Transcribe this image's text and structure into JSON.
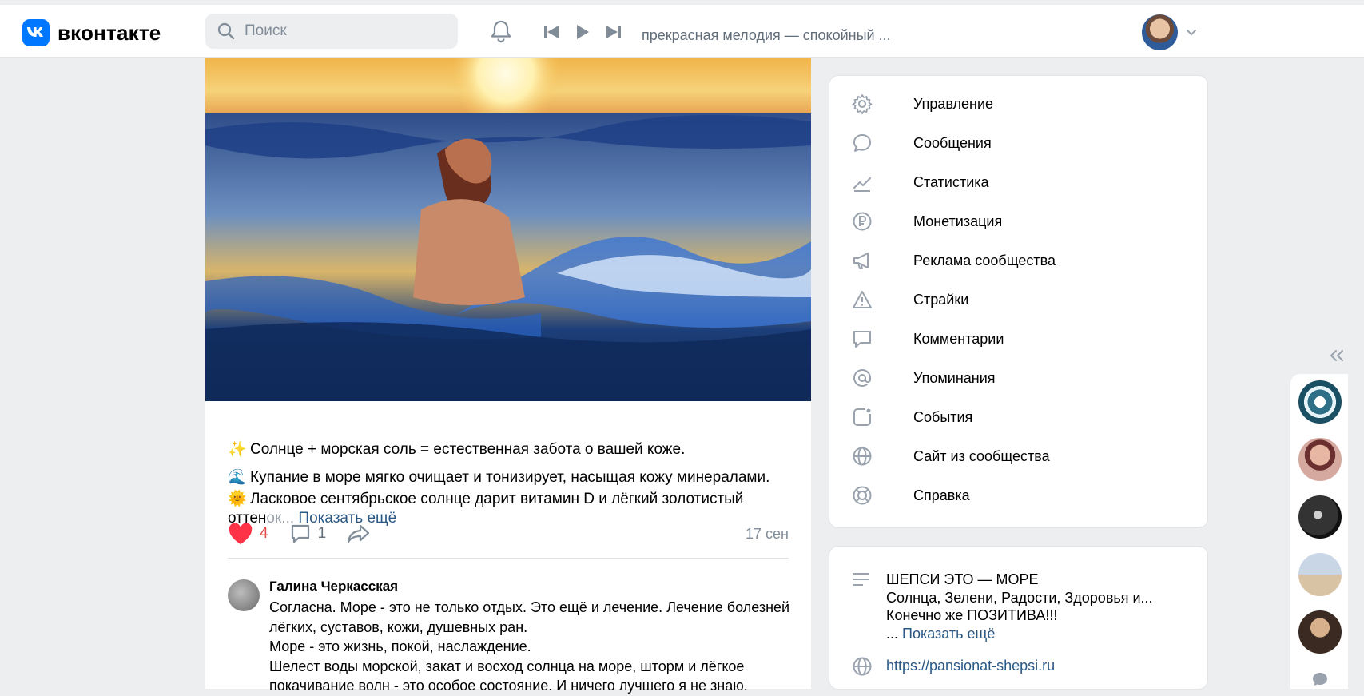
{
  "header": {
    "logo_text": "вконтакте",
    "search_placeholder": "Поиск",
    "track_title": "прекрасная мелодия — спокойный ...",
    "icons": [
      "vk-logo-icon",
      "search-icon",
      "bell-icon",
      "prev-track-icon",
      "play-icon",
      "next-track-icon",
      "chevron-down-icon"
    ]
  },
  "post": {
    "lines": [
      {
        "emoji": "✨",
        "text": "Солнце + морская соль = естественная забота о вашей коже."
      },
      {
        "emoji": "🌊",
        "text": "Купание в море мягко очищает и тонизирует, насыщая кожу минералами."
      },
      {
        "emoji": "🌞",
        "text": "Ласковое сентябрьское солнце дарит витамин D и лёгкий золотистый"
      }
    ],
    "line4_prefix": "оттен",
    "line4_faded": "ок...",
    "show_more": "Показать ещё",
    "likes": "4",
    "comments": "1",
    "date": "17 сен",
    "comment": {
      "author": "Галина Черкасская",
      "lines": [
        "Согласна. Море - это не только отдых. Это ещё и лечение. Лечение болезней",
        "лёгких, суставов, кожи, душевных ран.",
        "Море - это жизнь, покой, наслаждение.",
        "Шелест воды морской, закат и восход солнца на море, шторм и лёгкое",
        "покачивание волн - это особое состояние. И ничего лучшего я не знаю."
      ]
    }
  },
  "menu": {
    "items": [
      {
        "label": "Управление",
        "icon": "gear-icon"
      },
      {
        "label": "Сообщения",
        "icon": "message-icon"
      },
      {
        "label": "Статистика",
        "icon": "chart-icon"
      },
      {
        "label": "Монетизация",
        "icon": "ruble-icon"
      },
      {
        "label": "Реклама сообщества",
        "icon": "megaphone-icon"
      },
      {
        "label": "Страйки",
        "icon": "warning-icon"
      },
      {
        "label": "Комментарии",
        "icon": "comment-icon"
      },
      {
        "label": "Упоминания",
        "icon": "at-icon"
      },
      {
        "label": "События",
        "icon": "events-icon"
      },
      {
        "label": "Сайт из сообщества",
        "icon": "globe-icon"
      },
      {
        "label": "Справка",
        "icon": "help-icon"
      }
    ]
  },
  "about": {
    "line1": "ШЕПСИ ЭТО — МОРЕ",
    "line2": "Солнца, Зелени, Радости, Здоровья и...",
    "line3": "Конечно же ПОЗИТИВА!!!",
    "line4_prefix": "... ",
    "show_more": "Показать ещё",
    "link": "https://pansionat-shepsi.ru"
  },
  "colors": {
    "brand": "#0077ff",
    "link": "#2a5885",
    "like": "#e64646",
    "background": "#edeef0"
  }
}
